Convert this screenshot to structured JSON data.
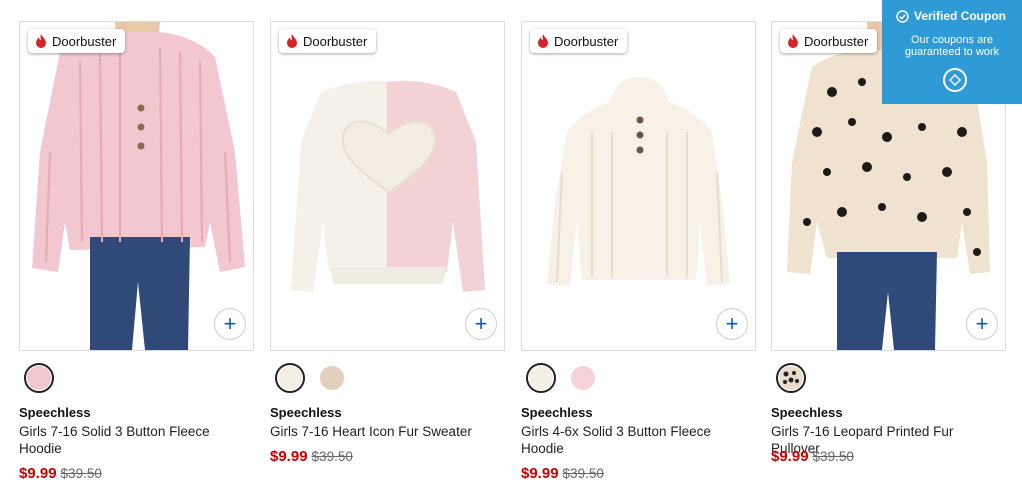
{
  "badge_label": "Doorbuster",
  "add_symbol": "+",
  "coupon": {
    "title": "Verified Coupon",
    "line1": "Our coupons are",
    "line2": "guaranteed to work",
    "icon": "badge-seal-icon"
  },
  "colors": {
    "sale": "#cc0000",
    "accent": "#0d56c9",
    "coupon_bg": "#2f9bd6"
  },
  "products": [
    {
      "brand": "Speechless",
      "title": "Girls 7-16 Solid 3 Button Fleece Hoodie",
      "sale_price": "$9.99",
      "orig_price": "$39.50",
      "swatches": [
        {
          "color": "#f1c6cd",
          "selected": true
        }
      ]
    },
    {
      "brand": "Speechless",
      "title": "Girls 7-16 Heart Icon Fur Sweater",
      "sale_price": "$9.99",
      "orig_price": "$39.50",
      "swatches": [
        {
          "color": "#f4efe6",
          "selected": true
        },
        {
          "color": "#e2cfbc",
          "selected": false
        }
      ]
    },
    {
      "brand": "Speechless",
      "title": "Girls 4-6x Solid 3 Button Fleece Hoodie",
      "sale_price": "$9.99",
      "orig_price": "$39.50",
      "swatches": [
        {
          "color": "#f4efe6",
          "selected": true
        },
        {
          "color": "#f5d2d7",
          "selected": false
        }
      ]
    },
    {
      "brand": "Speechless",
      "title": "Girls 7-16 Leopard Printed Fur Pullover",
      "sale_price": "$9.99",
      "orig_price": "$39.50",
      "swatches": [
        {
          "color": "#c9b6a0",
          "selected": true
        }
      ]
    }
  ]
}
